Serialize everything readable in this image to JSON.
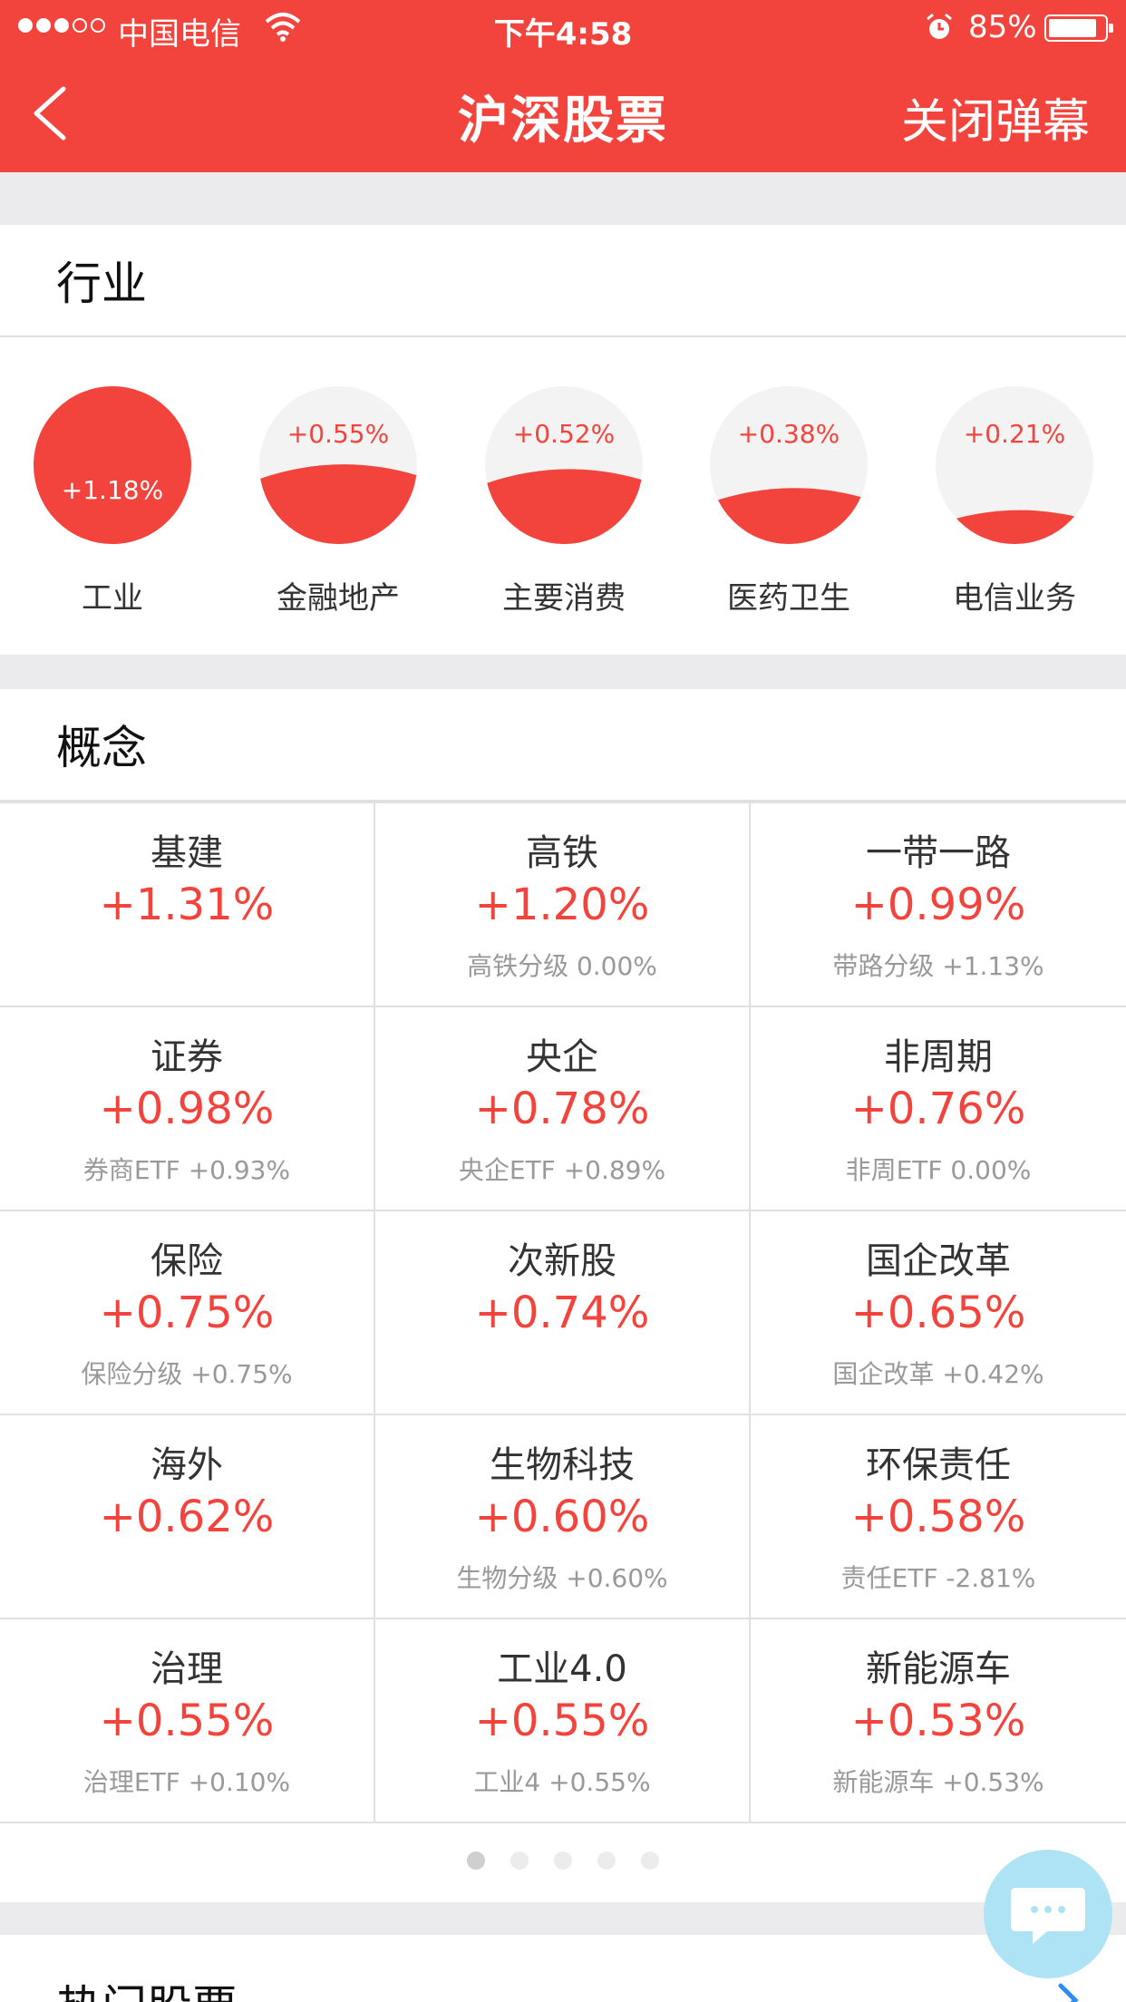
{
  "status": {
    "carrier": "中国电信",
    "time": "下午4:58",
    "battery": "85%"
  },
  "nav": {
    "title": "沪深股票",
    "right_action": "关闭弹幕"
  },
  "industry": {
    "title": "行业",
    "items": [
      {
        "name": "工业",
        "change": "+1.18%",
        "level": 1.0
      },
      {
        "name": "金融地产",
        "change": "+0.55%",
        "level": 0.47
      },
      {
        "name": "主要消费",
        "change": "+0.52%",
        "level": 0.44
      },
      {
        "name": "医药卫生",
        "change": "+0.38%",
        "level": 0.32
      },
      {
        "name": "电信业务",
        "change": "+0.21%",
        "level": 0.18
      }
    ]
  },
  "concept": {
    "title": "概念",
    "items": [
      {
        "name": "基建",
        "change": "+1.31%",
        "sub": ""
      },
      {
        "name": "高铁",
        "change": "+1.20%",
        "sub": "高铁分级 0.00%"
      },
      {
        "name": "一带一路",
        "change": "+0.99%",
        "sub": "带路分级 +1.13%"
      },
      {
        "name": "证券",
        "change": "+0.98%",
        "sub": "券商ETF +0.93%"
      },
      {
        "name": "央企",
        "change": "+0.78%",
        "sub": "央企ETF +0.89%"
      },
      {
        "name": "非周期",
        "change": "+0.76%",
        "sub": "非周ETF 0.00%"
      },
      {
        "name": "保险",
        "change": "+0.75%",
        "sub": "保险分级 +0.75%"
      },
      {
        "name": "次新股",
        "change": "+0.74%",
        "sub": ""
      },
      {
        "name": "国企改革",
        "change": "+0.65%",
        "sub": "国企改革 +0.42%"
      },
      {
        "name": "海外",
        "change": "+0.62%",
        "sub": ""
      },
      {
        "name": "生物科技",
        "change": "+0.60%",
        "sub": "生物分级 +0.60%"
      },
      {
        "name": "环保责任",
        "change": "+0.58%",
        "sub": "责任ETF -2.81%"
      },
      {
        "name": "治理",
        "change": "+0.55%",
        "sub": "治理ETF +0.10%"
      },
      {
        "name": "工业4.0",
        "change": "+0.55%",
        "sub": "工业4 +0.55%"
      },
      {
        "name": "新能源车",
        "change": "+0.53%",
        "sub": "新能源车 +0.53%"
      }
    ],
    "pages": 5,
    "active_page": 0
  },
  "hot": {
    "title": "热门股票"
  },
  "colors": {
    "accent": "#f2443c",
    "page_bg": "#ebebed",
    "chat_bubble": "#aee3f5"
  },
  "icons": {
    "back": "chevron-left-icon",
    "chat": "chat-bubble-icon",
    "more": "chevron-right-icon"
  }
}
